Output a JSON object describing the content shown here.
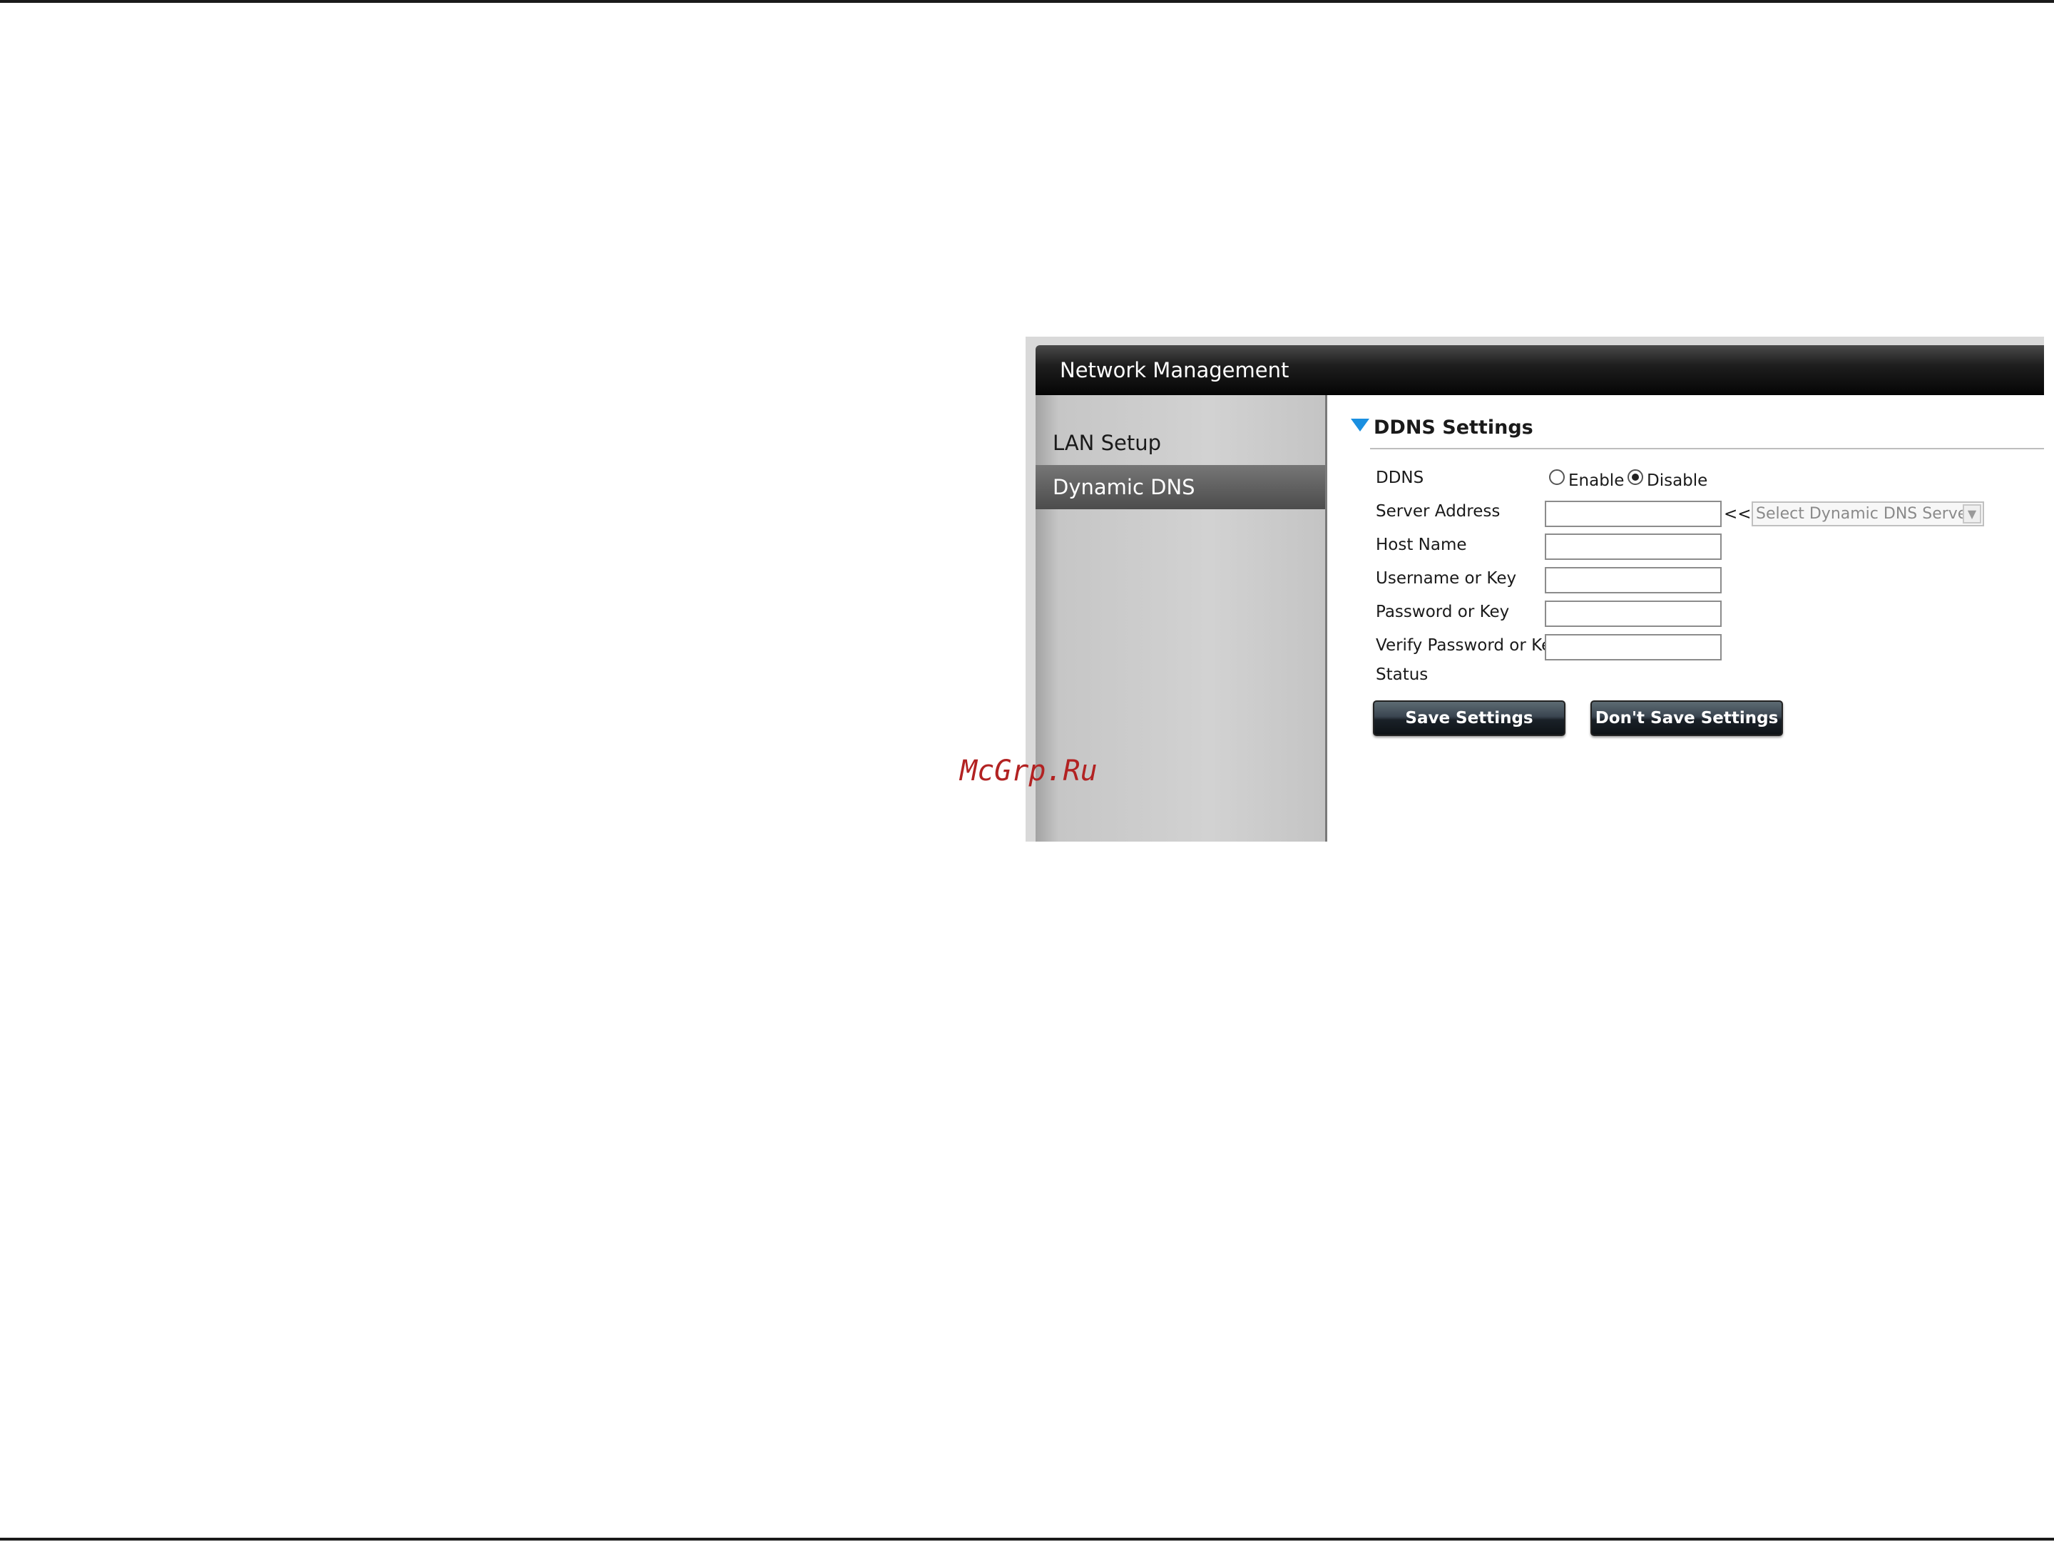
{
  "window": {
    "title": "Network Management"
  },
  "sidebar": {
    "items": [
      {
        "label": "LAN Setup",
        "active": false
      },
      {
        "label": "Dynamic DNS",
        "active": true
      }
    ]
  },
  "section": {
    "title": "DDNS Settings"
  },
  "ddns": {
    "label": "DDNS",
    "options": {
      "enable": "Enable",
      "disable": "Disable"
    },
    "selected": "Disable"
  },
  "form": {
    "server_address": {
      "label": "Server Address",
      "value": ""
    },
    "server_arrows": "<<",
    "server_select": {
      "value": "Select Dynamic DNS Server"
    },
    "host_name": {
      "label": "Host Name",
      "value": ""
    },
    "username": {
      "label": "Username or Key",
      "value": ""
    },
    "password": {
      "label": "Password or Key",
      "value": ""
    },
    "verify_password": {
      "label": "Verify Password or Key",
      "value": ""
    },
    "status": {
      "label": "Status"
    }
  },
  "buttons": {
    "save": "Save Settings",
    "dont_save": "Don't Save Settings"
  },
  "watermark": "McGrp.Ru",
  "colors": {
    "accent_triangle": "#1a8fe0",
    "watermark": "#b22222",
    "active_nav": "#5a5a5a"
  }
}
